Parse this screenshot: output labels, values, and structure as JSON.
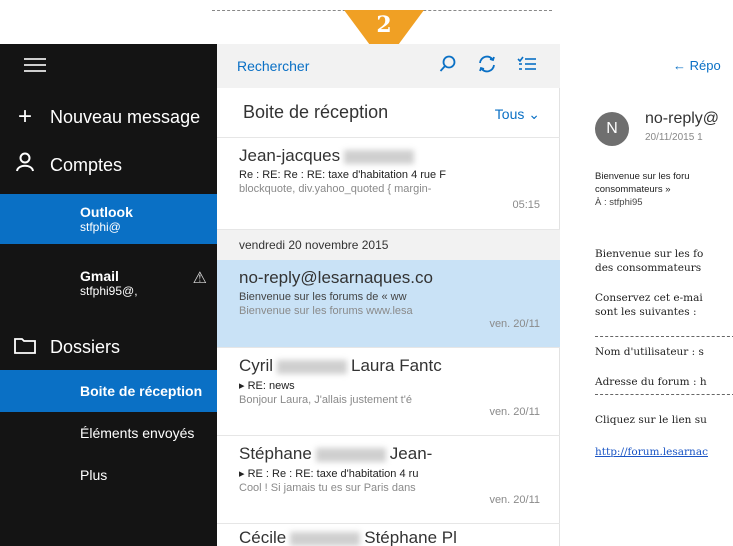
{
  "callout": {
    "number": "2"
  },
  "sidebar": {
    "new_message": "Nouveau message",
    "accounts": "Comptes",
    "account_list": [
      {
        "name": "Outlook",
        "email": "stfphi@",
        "selected": true
      },
      {
        "name": "Gmail",
        "email": "stfphi95@,",
        "selected": false,
        "warning": "⚠"
      }
    ],
    "folders": "Dossiers",
    "folder_list": [
      {
        "label": "Boite de réception",
        "selected": true
      },
      {
        "label": "Éléments envoyés",
        "selected": false
      },
      {
        "label": "Plus",
        "selected": false
      }
    ]
  },
  "list": {
    "search_label": "Rechercher",
    "inbox_title": "Boite de réception",
    "filter": "Tous",
    "messages": [
      {
        "from": "Jean-jacques",
        "subject": "Re : RE: Re : RE: taxe d'habitation 4 rue F",
        "preview": "blockquote, div.yahoo_quoted { margin-",
        "date": "05:15"
      },
      {
        "from": "no-reply@lesarnaques.co",
        "subject": "Bienvenue sur les forums de « ww",
        "preview": "Bienvenue sur les forums www.lesa",
        "date": "ven. 20/11"
      },
      {
        "from": "Cyril",
        "from_tail": "Laura Fantc",
        "subject": "RE: news",
        "preview": "Bonjour Laura, J'allais justement t'é",
        "date": "ven. 20/11"
      },
      {
        "from": "Stéphane",
        "from_tail": "Jean-",
        "subject": "RE : Re : RE: taxe d'habitation 4 ru",
        "preview": "Cool ! Si jamais tu es sur Paris dans",
        "date": "ven. 20/11"
      },
      {
        "from": "Cécile",
        "from_tail": "Stéphane Pl"
      }
    ],
    "date_separator": "vendredi 20 novembre 2015"
  },
  "reader": {
    "reply": "← Répo",
    "avatar": "N",
    "sender": "no-reply@",
    "date": "20/11/2015 1",
    "subject_line1": "Bienvenue sur les foru",
    "subject_line2": "consommateurs »",
    "to": "À : stfphi95",
    "body": [
      "Bienvenue sur les fo",
      "des consommateurs",
      "Conservez cet e-mai",
      "sont les suivantes :",
      "Nom d'utilisateur : s",
      "Adresse du forum : h",
      "Cliquez sur le lien su",
      "http://forum.lesarnac"
    ]
  }
}
